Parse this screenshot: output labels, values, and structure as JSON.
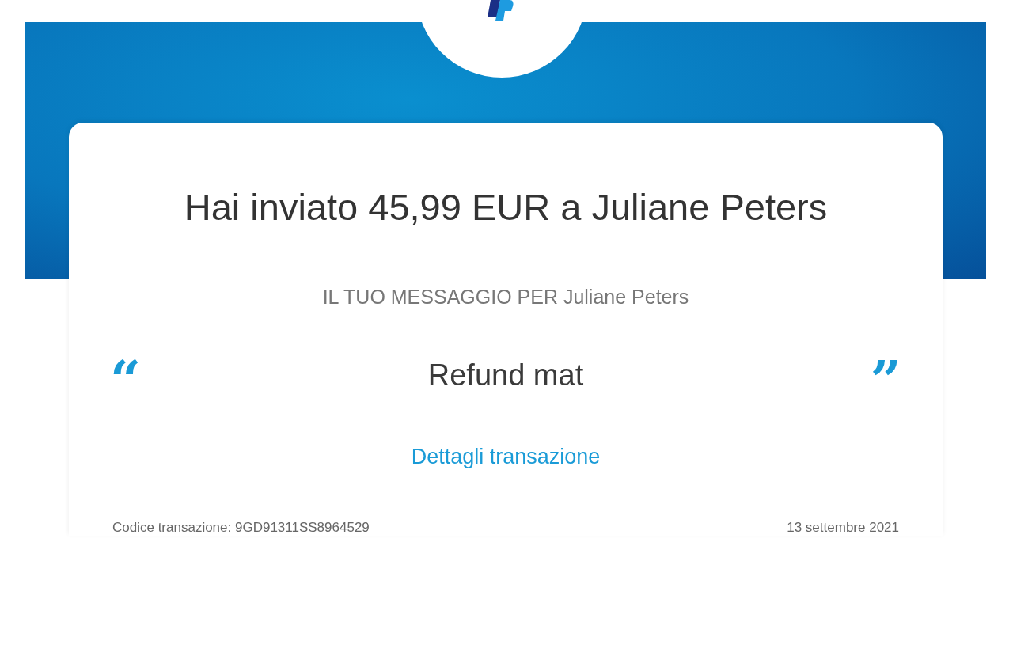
{
  "title": "Hai inviato 45,99 EUR a Juliane Peters",
  "message_label": "IL TUO MESSAGGIO PER Juliane Peters",
  "message": {
    "open_quote": "“",
    "text": "Refund mat",
    "close_quote": "”"
  },
  "details_link": "Dettagli transazione",
  "footer": {
    "transaction_code": "Codice transazione: 9GD91311SS8964529",
    "date": "13 settembre 2021"
  }
}
